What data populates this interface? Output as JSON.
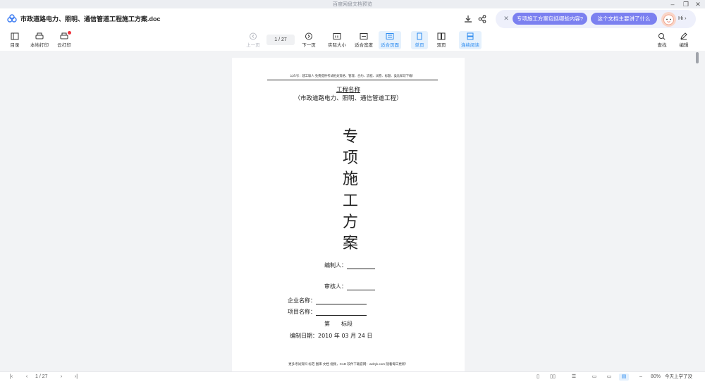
{
  "window": {
    "title": "百度网盘文档预览"
  },
  "header": {
    "doc_title": "市政道路电力、照明、通信管道工程施工方案.doc"
  },
  "ai_panel": {
    "chip1": "专项施工方案包括哪些内容?",
    "chip2": "这个文档主要讲了什么",
    "greeting": "Hi ›"
  },
  "toolbar": {
    "toc": "目录",
    "local_print": "本地打印",
    "cloud_print": "云打印",
    "prev_page": "上一页",
    "page_indicator": "1 / 27",
    "next_page": "下一页",
    "actual_size": "实际大小",
    "fit_width": "适合宽度",
    "fit_page": "适合页面",
    "single_page": "单页",
    "double_page": "双页",
    "continuous": "连续阅读",
    "search": "查找",
    "edit": "编辑"
  },
  "document": {
    "header_line": "公众号：建工联人 免费提供考试相关资格、管理、合约、流程、试卷、标题、类比知识下载！",
    "project_label": "工程名称",
    "project_name": "（市政道路电力、照明、通信管道工程）",
    "vertical_title": [
      "专",
      "项",
      "施",
      "工",
      "方",
      "案"
    ],
    "compiler_label": "编制人：",
    "reviewer_label": "审核人：",
    "company_label": "企业名称：",
    "project_name_label": "项目名称：",
    "section_label": "第　　标段",
    "date_label": "编制日期：2010 年 03 月 24 日",
    "footer_line": "更多考试资料 标范 图库 文档 视频，CAD 软件下载官网：wdzyk.com 随着每日更新！"
  },
  "statusbar": {
    "page_indicator": "1 / 27",
    "zoom": "80%",
    "watermark": "今天上学了没"
  },
  "colors": {
    "accent": "#2d8cf0",
    "ai_chip": "#7b80f0",
    "notification": "#f0323c"
  }
}
